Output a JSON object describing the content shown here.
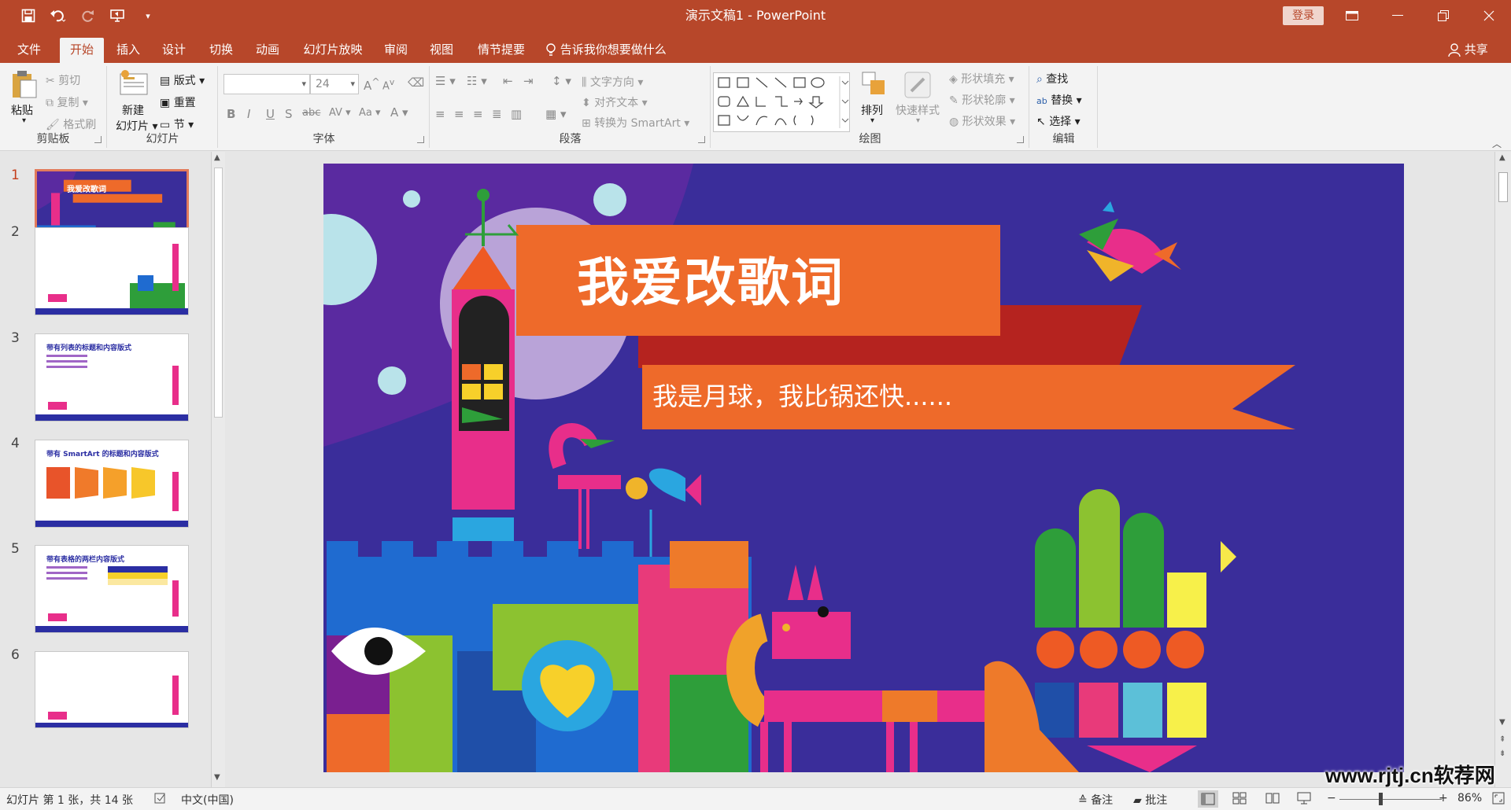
{
  "window": {
    "title": "演示文稿1 - PowerPoint",
    "login_label": "登录",
    "share_label": "共享",
    "tell_me": "告诉我你想要做什么"
  },
  "quick_access": [
    "save-icon",
    "undo-icon",
    "redo-icon",
    "start-from-beginning-icon",
    "customize-qat-icon"
  ],
  "tabs": [
    {
      "label": "文件",
      "active": false
    },
    {
      "label": "开始",
      "active": true
    },
    {
      "label": "插入",
      "active": false
    },
    {
      "label": "设计",
      "active": false
    },
    {
      "label": "切换",
      "active": false
    },
    {
      "label": "动画",
      "active": false
    },
    {
      "label": "幻灯片放映",
      "active": false
    },
    {
      "label": "审阅",
      "active": false
    },
    {
      "label": "视图",
      "active": false
    },
    {
      "label": "情节提要",
      "active": false
    }
  ],
  "ribbon": {
    "clipboard": {
      "label": "剪贴板",
      "paste": "粘贴",
      "cut": "剪切",
      "copy": "复制",
      "format_painter": "格式刷"
    },
    "slides": {
      "label": "幻灯片",
      "new_slide_1": "新建",
      "new_slide_2": "幻灯片",
      "layout": "版式",
      "reset": "重置",
      "section": "节"
    },
    "font": {
      "label": "字体",
      "font_name": "",
      "font_size": "24"
    },
    "paragraph": {
      "label": "段落",
      "text_direction": "文字方向",
      "align_text": "对齐文本",
      "convert_smartart": "转换为 SmartArt"
    },
    "drawing": {
      "label": "绘图",
      "arrange": "排列",
      "quick_styles": "快速样式",
      "shape_fill": "形状填充",
      "shape_outline": "形状轮廓",
      "shape_effects": "形状效果"
    },
    "editing": {
      "label": "编辑",
      "find": "查找",
      "replace": "替换",
      "select": "选择"
    }
  },
  "slides": [
    {
      "num": "1",
      "active": true,
      "title": "我爱改歌词",
      "subtitle": "我是月球，我比锅还快......"
    },
    {
      "num": "2",
      "active": false,
      "title": ""
    },
    {
      "num": "3",
      "active": false,
      "title": "带有列表的标题和内容版式"
    },
    {
      "num": "4",
      "active": false,
      "title": "带有 SmartArt 的标题和内容版式"
    },
    {
      "num": "5",
      "active": false,
      "title": "带有表格的两栏内容版式"
    },
    {
      "num": "6",
      "active": false,
      "title": ""
    }
  ],
  "statusbar": {
    "slide_info": "幻灯片 第 1 张，共 14 张",
    "language": "中文(中国)",
    "notes": "备注",
    "comments": "批注",
    "zoom": "86%"
  },
  "watermark": "www.rjtj.cn软荐网",
  "colors": {
    "accent": "#b7472a",
    "slide_bg": "#3a2d9a",
    "banner_orange": "#ee6a2a"
  }
}
